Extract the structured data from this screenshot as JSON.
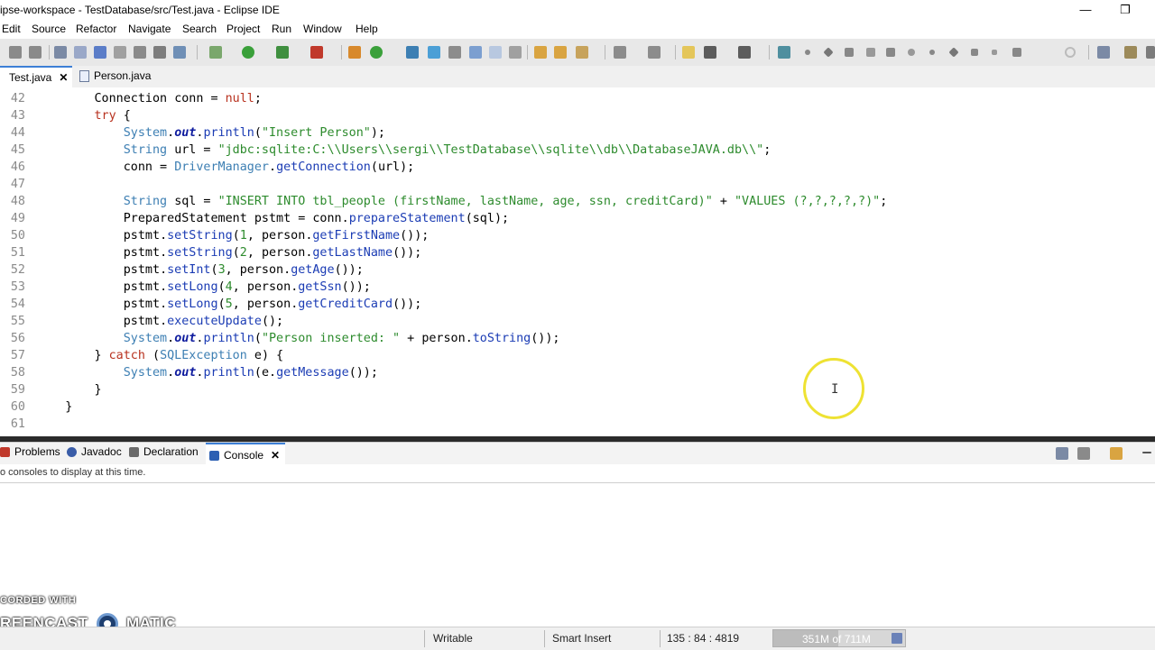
{
  "window": {
    "title": "ipse-workspace - TestDatabase/src/Test.java - Eclipse IDE",
    "minimize_glyph": "—",
    "restore_glyph": "❐"
  },
  "menu": [
    "Edit",
    "Source",
    "Refactor",
    "Navigate",
    "Search",
    "Project",
    "Run",
    "Window",
    "Help"
  ],
  "editor_tabs": [
    {
      "label": "Test.java",
      "active": true,
      "close": "✕"
    },
    {
      "label": "Person.java",
      "active": false
    }
  ],
  "code_lines": [
    {
      "n": "42",
      "text": "        Connection conn = null;"
    },
    {
      "n": "43",
      "text": "        try {"
    },
    {
      "n": "44",
      "text": "            System.out.println(\"Insert Person\");"
    },
    {
      "n": "45",
      "text": "            String url = \"jdbc:sqlite:C:\\\\Users\\\\sergi\\\\TestDatabase\\\\sqlite\\\\db\\\\DatabaseJAVA.db\\\\\";"
    },
    {
      "n": "46",
      "text": "            conn = DriverManager.getConnection(url);"
    },
    {
      "n": "47",
      "text": ""
    },
    {
      "n": "48",
      "text": "            String sql = \"INSERT INTO tbl_people (firstName, lastName, age, ssn, creditCard)\" + \"VALUES (?,?,?,?,?)\";"
    },
    {
      "n": "49",
      "text": "            PreparedStatement pstmt = conn.prepareStatement(sql);"
    },
    {
      "n": "50",
      "text": "            pstmt.setString(1, person.getFirstName());"
    },
    {
      "n": "51",
      "text": "            pstmt.setString(2, person.getLastName());"
    },
    {
      "n": "52",
      "text": "            pstmt.setInt(3, person.getAge());"
    },
    {
      "n": "53",
      "text": "            pstmt.setLong(4, person.getSsn());"
    },
    {
      "n": "54",
      "text": "            pstmt.setLong(5, person.getCreditCard());"
    },
    {
      "n": "55",
      "text": "            pstmt.executeUpdate();"
    },
    {
      "n": "56",
      "text": "            System.out.println(\"Person inserted: \" + person.toString());"
    },
    {
      "n": "57",
      "text": "        } catch (SQLException e) {"
    },
    {
      "n": "58",
      "text": "            System.out.println(e.getMessage());"
    },
    {
      "n": "59",
      "text": "        }"
    },
    {
      "n": "60",
      "text": "    }"
    },
    {
      "n": "61",
      "text": ""
    }
  ],
  "panel_tabs": [
    {
      "label": "Problems",
      "icon": "problems-icon",
      "color": "#c0392b"
    },
    {
      "label": "Javadoc",
      "icon": "javadoc-icon",
      "color": "#3a5da8"
    },
    {
      "label": "Declaration",
      "icon": "declaration-icon",
      "color": "#6a6a6a"
    },
    {
      "label": "Console",
      "icon": "console-icon",
      "color": "#2c5fb3",
      "active": true,
      "close": "✕"
    }
  ],
  "console": {
    "message": "o consoles to display at this time."
  },
  "watermark": {
    "line1": "CORDED WITH",
    "line2": "REENCAST",
    "line3": "MATIC"
  },
  "status": {
    "writable": "Writable",
    "insert_mode": "Smart Insert",
    "position": "135 : 84 : 4819",
    "heap": "351M of 711M",
    "heap_fraction": 0.49
  },
  "colors": {
    "accent": "#3c7fd6",
    "keyword": "#b8321f",
    "string": "#2d8b2d",
    "class": "#3d7fb3",
    "cursor_highlight": "#eee233"
  }
}
